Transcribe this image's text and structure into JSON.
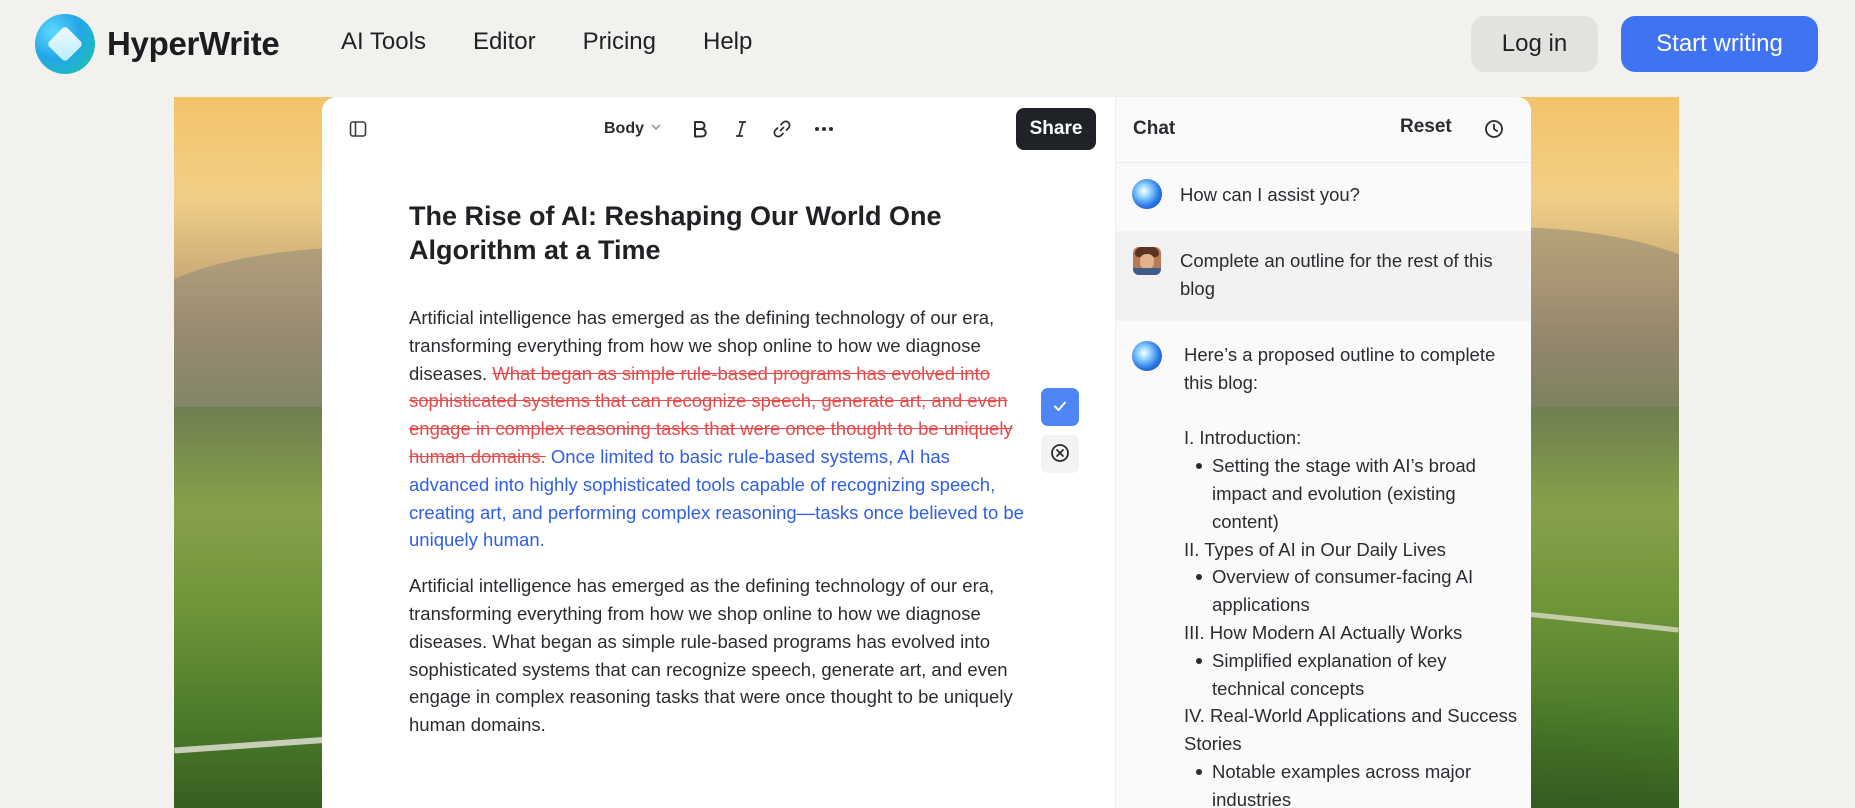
{
  "brand": {
    "name": "HyperWrite"
  },
  "nav": {
    "links": [
      "AI Tools",
      "Editor",
      "Pricing",
      "Help"
    ],
    "login_label": "Log in",
    "start_label": "Start writing"
  },
  "toolbar": {
    "style_select": "Body",
    "share_label": "Share"
  },
  "document": {
    "title": "The Rise of AI: Reshaping Our World One Algorithm at a Time",
    "para1_kept": "Artificial intelligence has emerged as the defining technology of our era, transforming everything from how we shop online to how we diagnose diseases. ",
    "para1_deleted": "What began as simple rule-based programs has evolved into sophisticated systems that can recognize speech, generate art, and even engage in complex reasoning tasks that were once thought to be uniquely human domains.",
    "para1_inserted": " Once limited to basic rule-based systems, AI has advanced into highly sophisticated tools capable of recognizing speech, creating art, and performing complex reasoning—tasks once believed to be uniquely human.",
    "para2": "Artificial intelligence has emerged as the defining technology of our era, transforming everything from how we shop online to how we diagnose diseases. What began as simple rule-based programs has evolved into sophisticated systems that can recognize speech, generate art, and even engage in complex reasoning tasks that were once thought to be uniquely human domains."
  },
  "chat": {
    "title": "Chat",
    "reset_label": "Reset",
    "greeting": "How can I assist you?",
    "user_message": "Complete an outline for the rest of this blog",
    "response_intro": "Here’s a proposed outline to complete this blog:",
    "outline": [
      {
        "section": "I. Introduction:",
        "points": [
          "Setting the stage with AI’s broad impact and evolution (existing content)"
        ]
      },
      {
        "section": "II. Types of AI in Our Daily Lives",
        "points": [
          "Overview of consumer-facing AI applications"
        ]
      },
      {
        "section": "III. How Modern AI Actually Works",
        "points": [
          "Simplified explanation of key technical concepts"
        ]
      },
      {
        "section": "IV. Real-World Applications and Success Stories",
        "points": [
          "Notable examples across major industries"
        ]
      }
    ]
  },
  "colors": {
    "accent": "#3f73f2",
    "deleted_text": "#e64a4a",
    "inserted_text": "#2f5fe8",
    "share_button": "#1f2328"
  },
  "icons": {
    "sidebar_toggle": "sidebar-toggle-icon",
    "bold": "bold-icon",
    "italic": "italic-icon",
    "link": "link-icon",
    "more": "more-icon",
    "accept": "check-icon",
    "reject": "close-circle-icon",
    "history": "clock-icon"
  }
}
